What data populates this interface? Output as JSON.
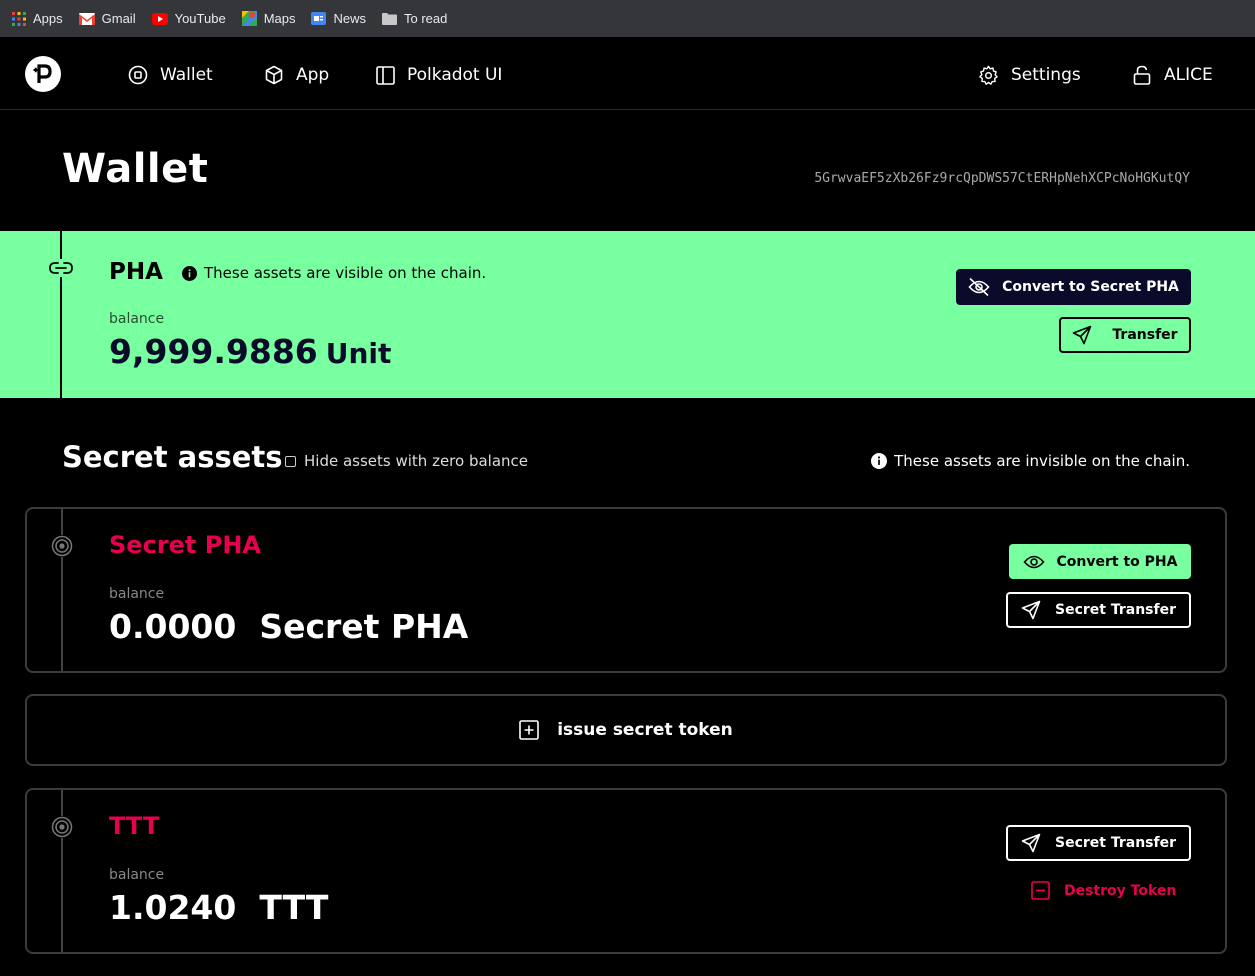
{
  "bookmarks": {
    "items": [
      {
        "label": "Apps",
        "icon": "apps-grid-icon"
      },
      {
        "label": "Gmail",
        "icon": "gmail-icon"
      },
      {
        "label": "YouTube",
        "icon": "youtube-icon"
      },
      {
        "label": "Maps",
        "icon": "maps-icon"
      },
      {
        "label": "News",
        "icon": "news-icon"
      },
      {
        "label": "To read",
        "icon": "folder-icon"
      }
    ]
  },
  "nav": {
    "wallet": "Wallet",
    "app": "App",
    "polkadot_ui": "Polkadot UI",
    "settings": "Settings",
    "account": "ALICE"
  },
  "header": {
    "title": "Wallet",
    "address": "5GrwvaEF5zXb26Fz9rcQpDWS57CtERHpNehXCPcNoHGKutQY"
  },
  "pha": {
    "name": "PHA",
    "note": "These assets are visible on the chain.",
    "balance_label": "balance",
    "balance_value": "9,999.9886",
    "balance_unit": "Unit",
    "convert_label": "Convert to Secret PHA",
    "transfer_label": "Transfer"
  },
  "secret": {
    "title": "Secret assets",
    "hide_zero_label": "Hide assets with zero balance",
    "note": "These assets are invisible on the chain.",
    "issue_label": "issue secret token",
    "assets": [
      {
        "name": "Secret PHA",
        "balance_label": "balance",
        "balance_text": "0.0000  Secret PHA",
        "convert_label": "Convert to PHA",
        "transfer_label": "Secret Transfer"
      },
      {
        "name": "TTT",
        "balance_label": "balance",
        "balance_text": "1.0240  TTT",
        "transfer_label": "Secret Transfer",
        "destroy_label": "Destroy Token"
      }
    ]
  },
  "colors": {
    "accent_green": "#78ff9f",
    "accent_red": "#e8004c",
    "dark_navy": "#0a0a2a"
  }
}
